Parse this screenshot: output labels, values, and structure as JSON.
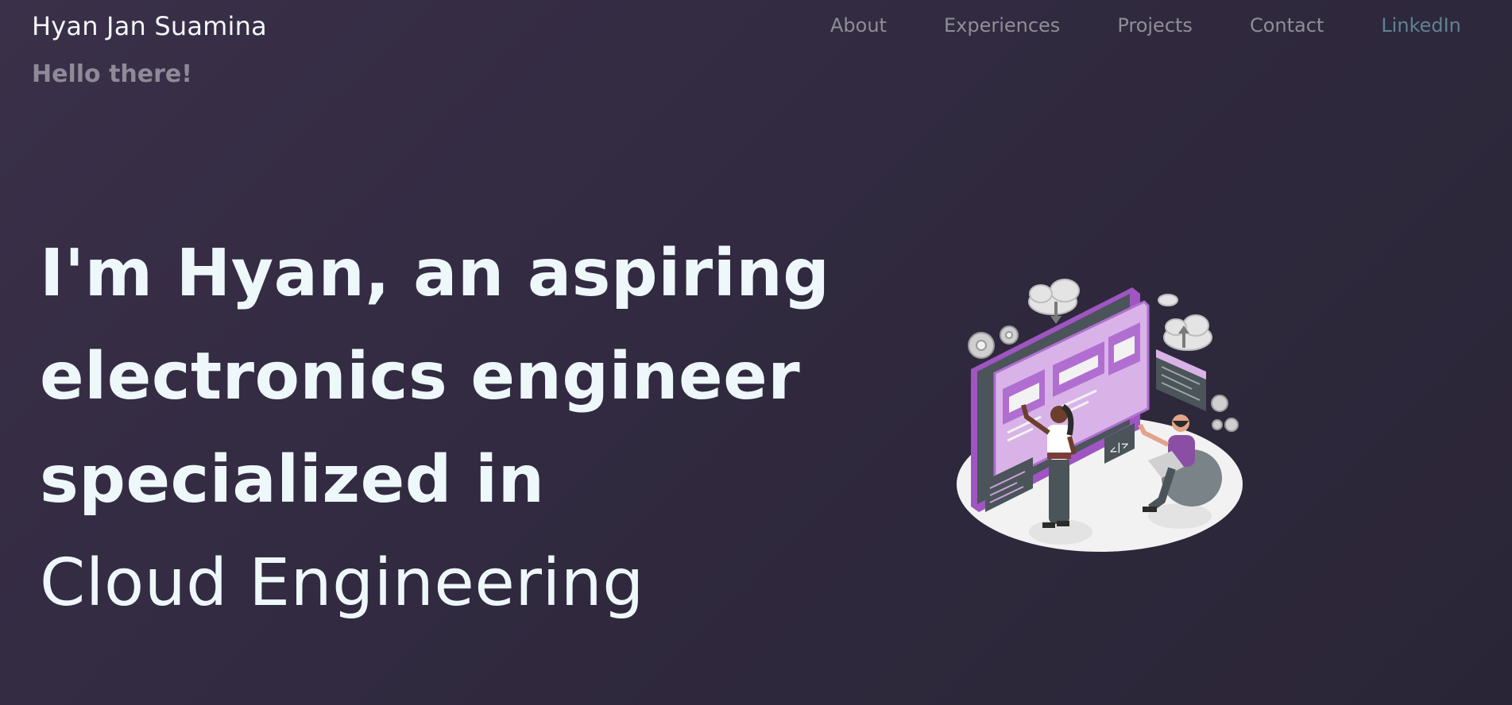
{
  "header": {
    "brand": "Hyan Jan Suamina",
    "nav": [
      {
        "label": "About"
      },
      {
        "label": "Experiences"
      },
      {
        "label": "Projects"
      },
      {
        "label": "Contact"
      },
      {
        "label": "LinkedIn"
      }
    ]
  },
  "hero": {
    "greeting": "Hello there!",
    "lines": [
      "I'm Hyan, an aspiring",
      "electronics engineer",
      "specialized in"
    ],
    "role": "Cloud Engineering"
  },
  "illustration": {
    "icon": "team-working-on-web-app-illustration"
  },
  "colors": {
    "background": "#342d43",
    "heading": "#eef8fb",
    "nav_link": "#8f8e96",
    "linkedin": "#5f8393",
    "accent_purple": "#b06fd0"
  }
}
